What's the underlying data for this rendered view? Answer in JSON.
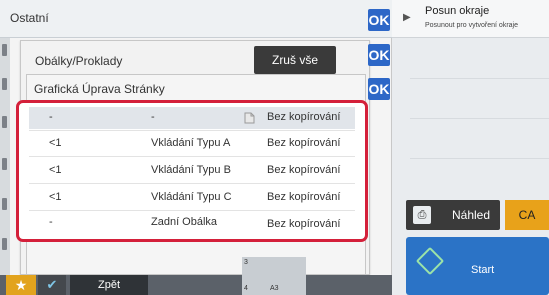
{
  "header": {
    "title": "Ostatní",
    "ok_label": "OK"
  },
  "mid_panel": {
    "title": "Obálky/Proklady",
    "clear_label": "Zruš vše",
    "ok_label": "OK"
  },
  "front_panel": {
    "title": "Grafická Úprava Stránky",
    "ok_label": "OK"
  },
  "list": {
    "rows": [
      {
        "col1": "-",
        "col2": "-",
        "col3": "Bez kopírování"
      },
      {
        "col1": "<1",
        "col2": "Vkládání Typu A",
        "col3": "Bez kopírování"
      },
      {
        "col1": "<1",
        "col2": "Vkládání Typu B",
        "col3": "Bez kopírování"
      },
      {
        "col1": "<1",
        "col2": "Vkládání Typu C",
        "col3": "Bez kopírování"
      },
      {
        "col1": "-",
        "col2": "Zadní Obálka",
        "col3": "Bez kopírování"
      }
    ]
  },
  "side": {
    "item_title": "Posun okraje",
    "item_subtitle": "Posunout pro vytvoření okraje",
    "preview_label": "Náhled",
    "ca_label": "CA",
    "start_label": "Start"
  },
  "bottom": {
    "back_label": "Zpět",
    "tray_top": "3",
    "tray_bottom": "4",
    "tray_size": "A3"
  },
  "colors": {
    "accent": "#2d67c7",
    "highlight": "#d4203a",
    "ca": "#e8a21a"
  }
}
